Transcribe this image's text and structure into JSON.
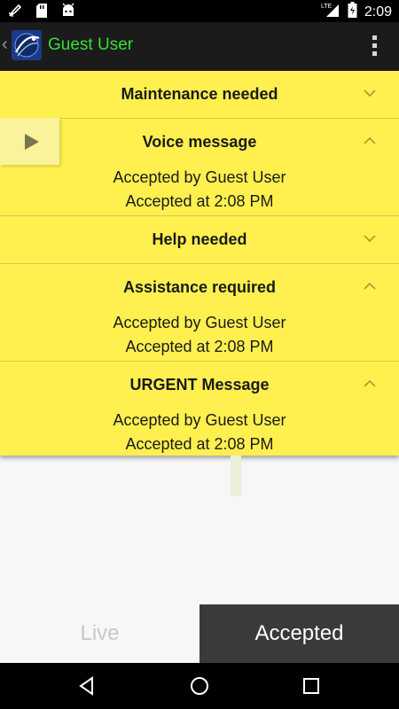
{
  "status_bar": {
    "time": "2:09",
    "network_label": "LTE",
    "icons": [
      "rocket-icon",
      "sd-card-icon",
      "android-icon",
      "signal-icon",
      "battery-icon"
    ]
  },
  "app_bar": {
    "title": "Guest User",
    "title_color": "#35e035",
    "icons": [
      "back-chevron-icon",
      "app-logo-icon",
      "overflow-menu-icon"
    ]
  },
  "messages": [
    {
      "title": "Maintenance needed",
      "expanded": false,
      "lines": []
    },
    {
      "title": "Voice message",
      "expanded": true,
      "lines": [
        "Accepted by Guest User",
        "Accepted at 2:08 PM"
      ]
    },
    {
      "title": "Help needed",
      "expanded": false,
      "lines": []
    },
    {
      "title": "Assistance required",
      "expanded": true,
      "lines": [
        "Accepted by Guest User",
        "Accepted at 2:08 PM"
      ]
    },
    {
      "title": "URGENT Message",
      "expanded": true,
      "lines": [
        "Accepted by Guest User",
        "Accepted at 2:08 PM"
      ]
    }
  ],
  "tabs": {
    "live_label": "Live",
    "accepted_label": "Accepted",
    "selected": "Accepted"
  },
  "colors": {
    "list_background": "#fff04f",
    "selected_tab": "#3a3a3a"
  },
  "nav_bar": {
    "icons": [
      "back-triangle-icon",
      "home-circle-icon",
      "recents-square-icon"
    ]
  }
}
